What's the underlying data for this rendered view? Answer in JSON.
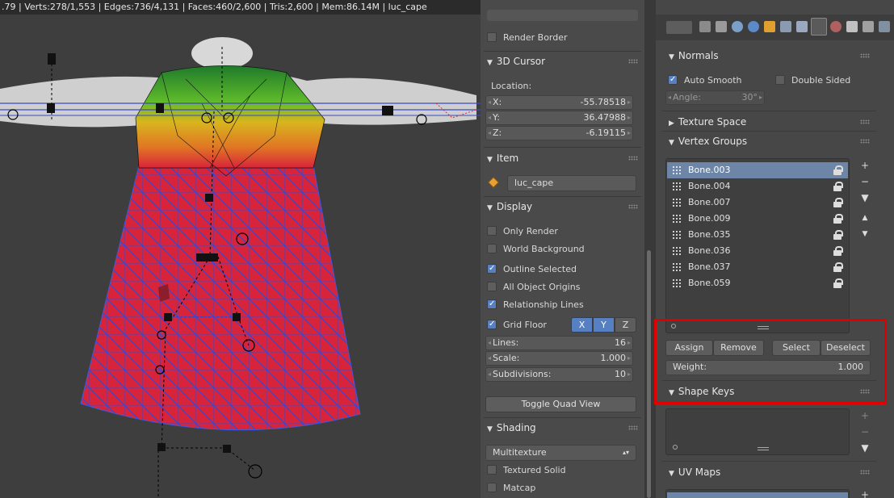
{
  "status_bar": {
    "text": ".79 | Verts:278/1,553 | Edges:736/4,131 | Faces:460/2,600 | Tris:2,600 | Mem:86.14M | luc_cape"
  },
  "npanel": {
    "render_border": "Render Border",
    "cursor3d": {
      "title": "3D Cursor",
      "location_label": "Location:",
      "x_label": "X:",
      "x": "-55.78518",
      "y_label": "Y:",
      "y": "36.47988",
      "z_label": "Z:",
      "z": "-6.19115"
    },
    "item": {
      "title": "Item",
      "name": "luc_cape"
    },
    "display": {
      "title": "Display",
      "only_render": "Only Render",
      "world_background": "World Background",
      "outline_selected": "Outline Selected",
      "all_object_origins": "All Object Origins",
      "relationship_lines": "Relationship Lines",
      "grid_floor": "Grid Floor",
      "axis_x": "X",
      "axis_y": "Y",
      "axis_z": "Z",
      "lines_label": "Lines:",
      "lines": "16",
      "scale_label": "Scale:",
      "scale": "1.000",
      "subdivisions_label": "Subdivisions:",
      "subdivisions": "10",
      "toggle_quad": "Toggle Quad View"
    },
    "shading": {
      "title": "Shading",
      "mode": "Multitexture",
      "textured_solid": "Textured Solid",
      "matcap": "Matcap"
    }
  },
  "properties": {
    "normals": {
      "title": "Normals",
      "auto_smooth": "Auto Smooth",
      "double_sided": "Double Sided",
      "angle_label": "Angle:",
      "angle": "30°"
    },
    "texture_space": "Texture Space",
    "vertex_groups": {
      "title": "Vertex Groups",
      "items": [
        "Bone.003",
        "Bone.004",
        "Bone.007",
        "Bone.009",
        "Bone.035",
        "Bone.036",
        "Bone.037",
        "Bone.059"
      ],
      "assign": "Assign",
      "remove": "Remove",
      "select": "Select",
      "deselect": "Deselect",
      "weight_label": "Weight:",
      "weight": "1.000"
    },
    "shape_keys": "Shape Keys",
    "uv_maps": "UV Maps"
  },
  "colors": {
    "selection_blue": "#5680c2",
    "highlight_red": "#e00000",
    "mesh_red": "#d8243a",
    "wire_blue": "#2a48d8"
  },
  "icons": [
    "add-icon",
    "remove-icon",
    "move-up-icon",
    "move-down-icon",
    "lock-icon",
    "vertex-group-icon",
    "object-icon"
  ]
}
